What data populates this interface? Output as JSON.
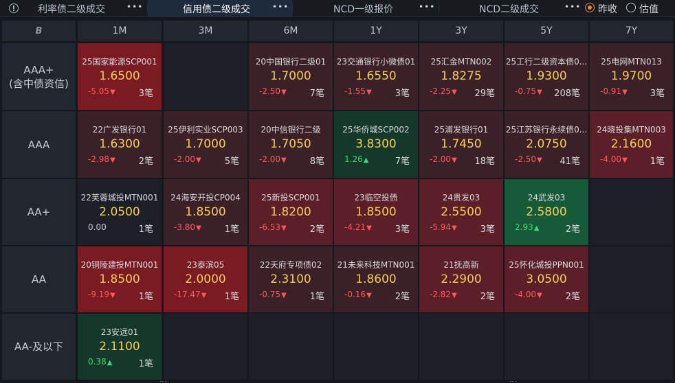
{
  "tabs": [
    {
      "label": "利率债二级成交",
      "active": false
    },
    {
      "label": "信用债二级成交",
      "active": true
    },
    {
      "label": "NCD一级报价",
      "active": false
    },
    {
      "label": "NCD二级成交",
      "active": false
    }
  ],
  "tab_menu_label": "•••",
  "radio_options": [
    {
      "label": "昨收",
      "selected": true
    },
    {
      "label": "估值",
      "selected": false
    }
  ],
  "corner_icon": "B",
  "tenors": [
    "1M",
    "3M",
    "6M",
    "1Y",
    "3Y",
    "5Y",
    "7Y"
  ],
  "ratings": [
    {
      "line1": "AAA+",
      "line2": "(含中债资信)"
    },
    {
      "line1": "AAA",
      "line2": ""
    },
    {
      "line1": "AA+",
      "line2": ""
    },
    {
      "line1": "AA",
      "line2": ""
    },
    {
      "line1": "AA-及以下",
      "line2": ""
    }
  ],
  "colors": {
    "down_strong": "#7a1a22",
    "down_mid": "#5c1f27",
    "down_weak": "#3b2127",
    "up_strong": "#175a38",
    "up_weak": "#14382a",
    "neutral": "#1c2026",
    "empty": "#1c2026",
    "price": "#f3cd5b",
    "down_text": "#ff5a5a",
    "up_text": "#43d67c"
  },
  "cells": [
    [
      {
        "name": "25国家能源SCP001",
        "price": "1.6500",
        "change": "-5.05",
        "dir": "down",
        "count": "3笔",
        "shade": "down_strong"
      },
      null,
      {
        "name": "20中国银行二级01",
        "price": "1.7000",
        "change": "-2.50",
        "dir": "down",
        "count": "7笔",
        "shade": "down_weak"
      },
      {
        "name": "23交通银行小微债01",
        "price": "1.6550",
        "change": "-1.55",
        "dir": "down",
        "count": "3笔",
        "shade": "down_weak"
      },
      {
        "name": "25汇金MTN002",
        "price": "1.8275",
        "change": "-2.25",
        "dir": "down",
        "count": "29笔",
        "shade": "down_weak"
      },
      {
        "name": "25工行二级资本债0...",
        "price": "1.9300",
        "change": "-0.75",
        "dir": "down",
        "count": "208笔",
        "shade": "down_weak"
      },
      {
        "name": "25电网MTN013",
        "price": "1.9700",
        "change": "-0.91",
        "dir": "down",
        "count": "3笔",
        "shade": "down_weak"
      }
    ],
    [
      {
        "name": "22广发银行01",
        "price": "1.6300",
        "change": "-2.98",
        "dir": "down",
        "count": "2笔",
        "shade": "down_weak"
      },
      {
        "name": "25伊利实业SCP003",
        "price": "1.7000",
        "change": "-2.00",
        "dir": "down",
        "count": "5笔",
        "shade": "down_weak"
      },
      {
        "name": "20中信银行二级",
        "price": "1.7050",
        "change": "-2.00",
        "dir": "down",
        "count": "8笔",
        "shade": "down_weak"
      },
      {
        "name": "25华侨城SCP002",
        "price": "3.8300",
        "change": "1.26",
        "dir": "up",
        "count": "7笔",
        "shade": "up_weak"
      },
      {
        "name": "25浦发银行01",
        "price": "1.7450",
        "change": "-2.00",
        "dir": "down",
        "count": "18笔",
        "shade": "down_weak"
      },
      {
        "name": "25江苏银行永续债0...",
        "price": "2.0750",
        "change": "-2.50",
        "dir": "down",
        "count": "41笔",
        "shade": "down_weak"
      },
      {
        "name": "24晓投集MTN003",
        "price": "2.1600",
        "change": "-4.00",
        "dir": "down",
        "count": "1笔",
        "shade": "down_mid"
      }
    ],
    [
      {
        "name": "22芙蓉城投MTN001",
        "price": "2.0500",
        "change": "0.00",
        "dir": "flat",
        "count": "1笔",
        "shade": "neutral"
      },
      {
        "name": "24海安开投CP004",
        "price": "1.8500",
        "change": "-3.80",
        "dir": "down",
        "count": "1笔",
        "shade": "down_weak"
      },
      {
        "name": "25新投SCP001",
        "price": "1.8200",
        "change": "-6.53",
        "dir": "down",
        "count": "2笔",
        "shade": "down_mid"
      },
      {
        "name": "23临空投债",
        "price": "1.8500",
        "change": "-4.21",
        "dir": "down",
        "count": "3笔",
        "shade": "down_mid"
      },
      {
        "name": "24贵发03",
        "price": "2.5500",
        "change": "-5.94",
        "dir": "down",
        "count": "3笔",
        "shade": "down_mid"
      },
      {
        "name": "24武发03",
        "price": "2.5800",
        "change": "2.93",
        "dir": "up",
        "count": "2笔",
        "shade": "up_strong"
      },
      null
    ],
    [
      {
        "name": "20铜陵建投MTN001",
        "price": "1.8500",
        "change": "-9.19",
        "dir": "down",
        "count": "1笔",
        "shade": "down_strong"
      },
      {
        "name": "23泰滨05",
        "price": "2.0000",
        "change": "-17.47",
        "dir": "down",
        "count": "1笔",
        "shade": "down_strong"
      },
      {
        "name": "22天府专项债02",
        "price": "2.3100",
        "change": "-0.75",
        "dir": "down",
        "count": "1笔",
        "shade": "down_weak"
      },
      {
        "name": "21未来科技MTN001",
        "price": "1.8600",
        "change": "-0.16",
        "dir": "down",
        "count": "2笔",
        "shade": "down_weak"
      },
      {
        "name": "21抚高新",
        "price": "2.2900",
        "change": "-2.82",
        "dir": "down",
        "count": "2笔",
        "shade": "down_mid"
      },
      {
        "name": "25怀化城投PPN001",
        "price": "3.0500",
        "change": "-4.00",
        "dir": "down",
        "count": "2笔",
        "shade": "down_mid"
      },
      null
    ],
    [
      {
        "name": "23安远01",
        "price": "2.1100",
        "change": "0.38",
        "dir": "up",
        "count": "1笔",
        "shade": "up_weak"
      },
      null,
      null,
      null,
      null,
      null,
      null
    ]
  ]
}
